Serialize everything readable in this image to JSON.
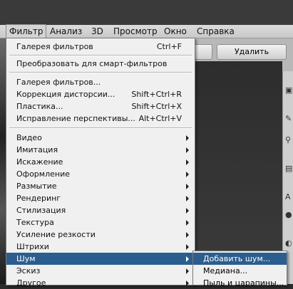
{
  "menubar": {
    "items": [
      "Фильтр",
      "Анализ",
      "3D",
      "Просмотр",
      "Окно",
      "Справка"
    ]
  },
  "panel": {
    "delete_label": "Удалить"
  },
  "menu": {
    "group1": [
      {
        "label": "Галерея фильтров",
        "shortcut": "Ctrl+F"
      }
    ],
    "group2": [
      {
        "label": "Преобразовать для смарт-фильтров"
      }
    ],
    "group3": [
      {
        "label": "Галерея фильтров...",
        "shortcut": ""
      },
      {
        "label": "Коррекция дисторсии...",
        "shortcut": "Shift+Ctrl+R"
      },
      {
        "label": "Пластика...",
        "shortcut": "Shift+Ctrl+X"
      },
      {
        "label": "Исправление перспективы...",
        "shortcut": "Alt+Ctrl+V"
      }
    ],
    "submenus": [
      {
        "label": "Видео"
      },
      {
        "label": "Имитация"
      },
      {
        "label": "Искажение"
      },
      {
        "label": "Оформление"
      },
      {
        "label": "Размытие"
      },
      {
        "label": "Рендеринг"
      },
      {
        "label": "Стилизация"
      },
      {
        "label": "Текстура"
      },
      {
        "label": "Усиление резкости"
      },
      {
        "label": "Штрихи"
      },
      {
        "label": "Шум"
      },
      {
        "label": "Эскиз"
      },
      {
        "label": "Другое"
      }
    ],
    "highlighted_index": 10
  },
  "submenu": {
    "items": [
      {
        "label": "Добавить шум..."
      },
      {
        "label": "Медиана..."
      },
      {
        "label": "Пыль и царапины..."
      }
    ]
  },
  "colors": {
    "highlight": "#2b5e8e",
    "menu_bg": "#f0f0f0"
  }
}
